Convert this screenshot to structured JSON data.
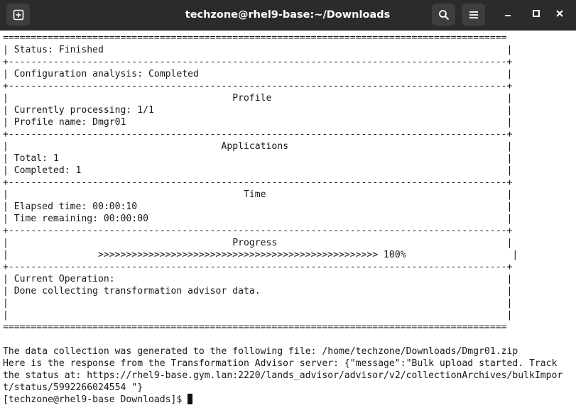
{
  "window": {
    "title": "techzone@rhel9-base:~/Downloads",
    "icons": [
      "new-tab-icon",
      "search-icon",
      "hamburger-menu-icon",
      "minimize-icon",
      "maximize-icon",
      "close-icon"
    ]
  },
  "colors": {
    "titlebar_bg": "#2b2b2b",
    "button_bg": "#3e3e3e",
    "terminal_bg": "#ffffff",
    "terminal_fg": "#1a1a1a"
  },
  "terminal": {
    "lines": [
      "==========================================================================================",
      "| Status: Finished                                                                        |",
      "+-----------------------------------------------------------------------------------------+",
      "| Configuration analysis: Completed                                                       |",
      "+-----------------------------------------------------------------------------------------+",
      "|                                        Profile                                          |",
      "| Currently processing: 1/1                                                               |",
      "| Profile name: Dmgr01                                                                    |",
      "+-----------------------------------------------------------------------------------------+",
      "|                                      Applications                                       |",
      "| Total: 1                                                                                |",
      "| Completed: 1                                                                            |",
      "+-----------------------------------------------------------------------------------------+",
      "|                                          Time                                           |",
      "| Elapsed time: 00:00:10                                                                  |",
      "| Time remaining: 00:00:00                                                                |",
      "+-----------------------------------------------------------------------------------------+",
      "|                                        Progress                                         |",
      "|                >>>>>>>>>>>>>>>>>>>>>>>>>>>>>>>>>>>>>>>>>>>>>>>>>> 100%                   |",
      "+-----------------------------------------------------------------------------------------+",
      "| Current Operation:                                                                      |",
      "| Done collecting transformation advisor data.                                            |",
      "|                                                                                         |",
      "|                                                                                         |",
      "==========================================================================================",
      "",
      "The data collection was generated to the following file: /home/techzone/Downloads/Dmgr01.zip",
      "Here is the response from the Transformation Advisor server: {\"message\":\"Bulk upload started. Track",
      "the status at: https://rhel9-base.gym.lan:2220/lands_advisor/advisor/v2/collectionArchives/bulkImpor",
      "t/status/5992266024554 \"}"
    ],
    "prompt": "[techzone@rhel9-base Downloads]$ "
  }
}
